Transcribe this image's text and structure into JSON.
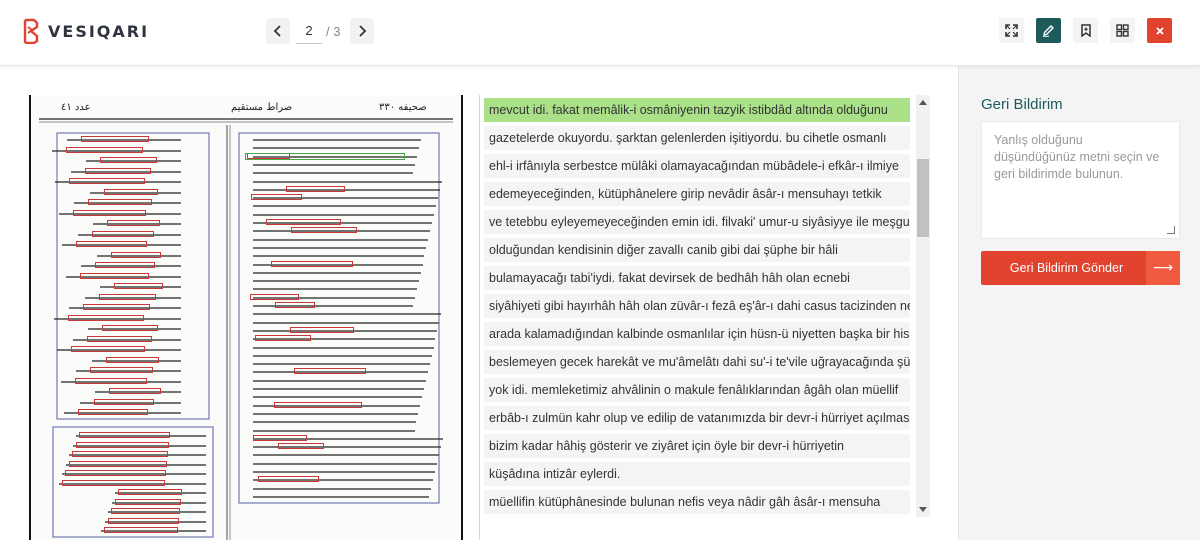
{
  "app": {
    "brand": "VESIQARI",
    "accent": "#1d5b5b",
    "danger": "#e2432f",
    "highlight": "#a9e088"
  },
  "pager": {
    "current": "2",
    "total": "/ 3"
  },
  "toolbar": {
    "icons": [
      "fullscreen-icon",
      "edit-icon",
      "bookmark-icon",
      "grid-icon",
      "close-icon"
    ]
  },
  "scan": {
    "header_right": "صحيفه ٣٣٠",
    "header_center": "صراط مستقيم",
    "header_left": "عدد ٤١"
  },
  "transcript": {
    "lines": [
      "mevcut idi. fakat memâlik-i osmâniyenin tazyik istibdâd altında olduğunu",
      "gazetelerde okuyordu. şarktan gelenlerden işitiyordu. bu cihetle osmanlı",
      "ehl-i irfânıyla serbestce mülâki olamayacağından mübâdele-i efkâr-ı ilmiye",
      "edemeyeceğinden, kütüphânelere girip nevâdir âsâr-ı mensuhayı tetkik",
      "ve tetebbu eyleyemeyeceğinden emin idi. filvaki' umur-u siyâsiyye ile meşgul",
      "olduğundan kendisinin diğer zavallı canib gibi dai şüphe bir hâli",
      "bulamayacağı tabi'iydi. fakat devirsek de bedhâh hâh olan ecnebi",
      "siyâhiyeti gibi hayırhâh hâh olan züvâr-ı fezâ eş'âr-ı dahi casus tacizinden neden",
      "arada kalamadığından kalbinde osmanlılar için hüsn-ü niyetten başka bir hiss-i",
      "beslemeyen gecek harekât ve mu'âmelâtı dahi su'-i te'vile uğrayacağında şüphe",
      "yok idi. memleketimiz ahvâlinin o makule fenâlıklarından âgâh olan müellif",
      "erbâb-ı zulmün kahr olup ve edilip de vatanımızda bir devr-i hürriyet açılmasına",
      "bizim kadar hâhiş gösterir ve ziyâret için öyle bir devr-i hürriyetin",
      "küşâdına intizâr eylerdi.",
      "müellifin kütüphânesinde bulunan nefis veya nâdir gâh âsâr-ı mensuha"
    ]
  },
  "feedback": {
    "title": "Geri Bildirim",
    "placeholder": "Yanlış olduğunu düşündüğünüz metni seçin ve geri bildirimde bulunun.",
    "submit_label": "Geri Bildirim Gönder",
    "submit_icon": "arrow-right-icon"
  }
}
